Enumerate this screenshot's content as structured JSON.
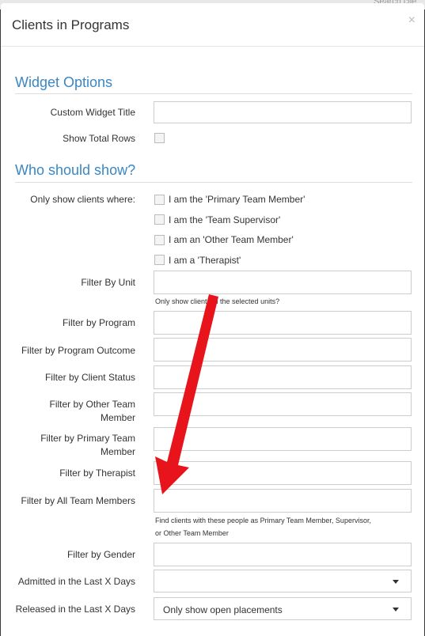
{
  "background": {
    "search_placeholder": "Search clie"
  },
  "modal": {
    "title": "Clients in Programs",
    "close_glyph": "×"
  },
  "sections": {
    "widget_options": "Widget Options",
    "who_should_show": "Who should show?"
  },
  "fields": {
    "custom_widget_title": "Custom Widget Title",
    "show_total_rows": "Show Total Rows",
    "only_show_clients_where": "Only show clients where:",
    "filter_by_unit": "Filter By Unit",
    "filter_by_program": "Filter by Program",
    "filter_by_program_outcome": "Filter by Program Outcome",
    "filter_by_client_status": "Filter by Client Status",
    "filter_by_other_team_member": "Filter by Other Team Member",
    "filter_by_primary_team_member": "Filter by Primary Team Member",
    "filter_by_therapist": "Filter by Therapist",
    "filter_by_all_team_members": "Filter by All Team Members",
    "filter_by_gender": "Filter by Gender",
    "admitted_last_x_days": "Admitted in the Last X Days",
    "released_last_x_days": "Released in the Last X Days"
  },
  "checkbox_options": {
    "primary": "I am the 'Primary Team Member'",
    "supervisor": "I am the 'Team Supervisor'",
    "other": "I am an 'Other Team Member'",
    "therapist": "I am a 'Therapist'"
  },
  "help": {
    "units": "Only show clients in the selected units?",
    "all_team_line1": "Find clients with these people as Primary Team Member, Supervisor,",
    "all_team_line2": "or Other Team Member"
  },
  "selects": {
    "admitted_value": "",
    "released_value": "Only show open placements"
  },
  "colors": {
    "section_title": "#3a87c4",
    "annotation_arrow": "#e8141c"
  }
}
